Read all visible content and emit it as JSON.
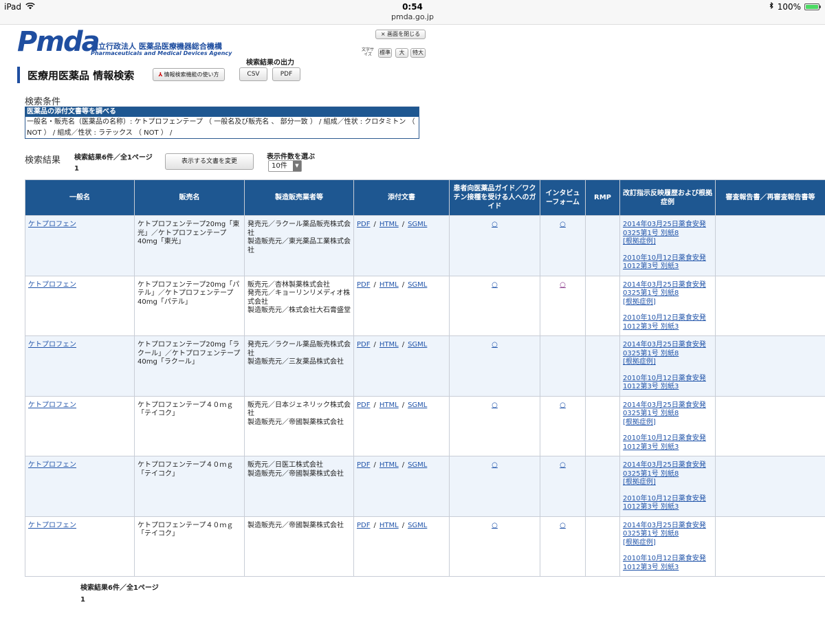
{
  "statusbar": {
    "device": "iPad",
    "time": "0:54",
    "url": "pmda.go.jp",
    "battery": "100%"
  },
  "header": {
    "logo_mark": "Pmda",
    "logo_jp": "独立行政法人 医薬品医療機器総合機構",
    "logo_en": "Pharmaceuticals and Medical Devices Agency",
    "close_button": "× 画面を閉じる",
    "size_label": "文字サイズ",
    "size_options": [
      "標準",
      "大",
      "特大"
    ],
    "page_title": "医療用医薬品 情報検索",
    "guide_button": "情報検索機能の使い方",
    "output_label": "検索結果の出力",
    "csv_button": "CSV",
    "pdf_button": "PDF"
  },
  "conditions": {
    "title": "検索条件",
    "head": "医薬品の添付文書等を調べる",
    "body": "一般名・販売名（医薬品の名称）: ケトプロフェンテープ （ 一般名及び販売名 、 部分一致 ） / 組成／性状 : クロタミトン （ NOT ） / 組成／性状 : ラテックス （ NOT ） /"
  },
  "results": {
    "title": "検索結果",
    "count": "検索結果6件／全1ページ",
    "page": "1",
    "change_button": "表示する文書を変更",
    "perpage_label": "表示件数を選ぶ",
    "perpage_value": "10件"
  },
  "table": {
    "headers": [
      "一般名",
      "販売名",
      "製造販売業者等",
      "添付文書",
      "患者向医薬品ガイド／ワクチン接種を受ける人へのガイド",
      "インタビューフォーム",
      "RMP",
      "改訂指示反映履歴および根拠症例",
      "審査報告書／再審査報告書等"
    ],
    "doc_links": [
      "PDF",
      "HTML",
      "SGML"
    ],
    "separator": "/",
    "circle": "○",
    "history": [
      "2014年03月25日薬食安発0325第1号 別紙8",
      "[根拠症例]",
      "2010年10月12日薬食安発1012第3号 別紙3"
    ],
    "rows": [
      {
        "generic": "ケトプロフェン",
        "brand": "ケトプロフェンテープ20mg「東光」／ケトプロフェンテープ40mg「東光」",
        "maker": "発売元／ラクール薬品販売株式会社\n製造販売元／東光薬品工業株式会社",
        "guide": "○",
        "interview": "○"
      },
      {
        "generic": "ケトプロフェン",
        "brand": "ケトプロフェンテープ20mg「パテル」／ケトプロフェンテープ40mg「パテル」",
        "maker": "販売元／杏林製薬株式会社\n発売元／キョーリンリメディオ株式会社\n製造販売元／株式会社大石膏盛堂",
        "guide": "○",
        "interview": "○"
      },
      {
        "generic": "ケトプロフェン",
        "brand": "ケトプロフェンテープ20mg「ラクール」／ケトプロフェンテープ40mg「ラクール」",
        "maker": "発売元／ラクール薬品販売株式会社\n製造販売元／三友薬品株式会社",
        "guide": "○",
        "interview": ""
      },
      {
        "generic": "ケトプロフェン",
        "brand": "ケトプロフェンテープ４０ｍｇ「テイコク」",
        "maker": "販売元／日本ジェネリック株式会社\n製造販売元／帝國製薬株式会社",
        "guide": "○",
        "interview": "○"
      },
      {
        "generic": "ケトプロフェン",
        "brand": "ケトプロフェンテープ４０ｍｇ「テイコク」",
        "maker": "販売元／日医工株式会社\n製造販売元／帝國製薬株式会社",
        "guide": "○",
        "interview": "○"
      },
      {
        "generic": "ケトプロフェン",
        "brand": "ケトプロフェンテープ４０ｍｇ「テイコク」",
        "maker": "製造販売元／帝國製薬株式会社",
        "guide": "○",
        "interview": "○"
      }
    ]
  },
  "footer": {
    "count": "検索結果6件／全1ページ",
    "page": "1"
  }
}
